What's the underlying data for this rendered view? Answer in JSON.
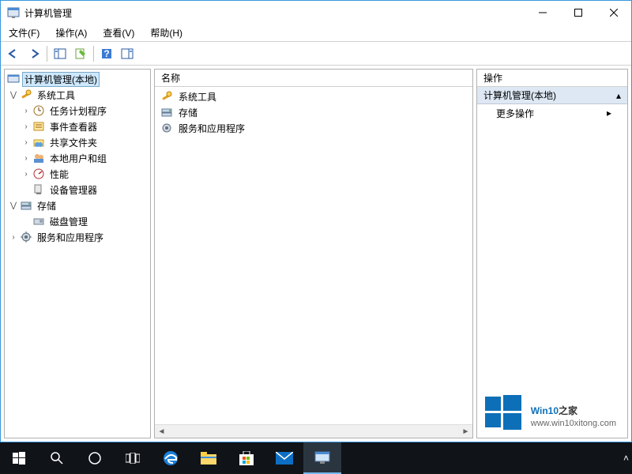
{
  "window": {
    "title": "计算机管理"
  },
  "menu": {
    "file": "文件(F)",
    "action": "操作(A)",
    "view": "查看(V)",
    "help": "帮助(H)"
  },
  "tree": {
    "root": "计算机管理(本地)",
    "system_tools": "系统工具",
    "task_scheduler": "任务计划程序",
    "event_viewer": "事件查看器",
    "shared_folders": "共享文件夹",
    "local_users": "本地用户和组",
    "performance": "性能",
    "device_manager": "设备管理器",
    "storage": "存储",
    "disk_management": "磁盘管理",
    "services_apps": "服务和应用程序"
  },
  "list": {
    "header_name": "名称",
    "item_system_tools": "系统工具",
    "item_storage": "存储",
    "item_services_apps": "服务和应用程序"
  },
  "actions": {
    "header": "操作",
    "group": "计算机管理(本地)",
    "more": "更多操作"
  },
  "watermark": {
    "brand_a": "Win10",
    "brand_b": "之家",
    "url": "www.win10xitong.com"
  }
}
